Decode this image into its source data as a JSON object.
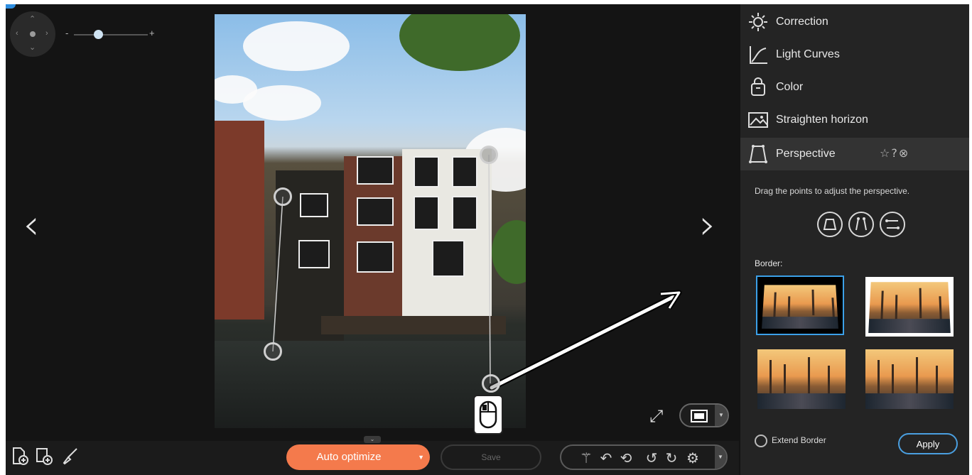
{
  "colors": {
    "accent_orange": "#f47a4c",
    "accent_blue": "#4a9fe0",
    "panel_bg": "#242424",
    "canvas_bg": "#141414"
  },
  "navigator": {
    "icon": "navigation-pad-icon",
    "zoom_minus": "-",
    "zoom_plus": "+",
    "zoom_level_fraction": 0.33
  },
  "nav_arrows": {
    "prev": "‹",
    "next": "›"
  },
  "sidebar": {
    "items": [
      {
        "label": "Correction",
        "icon": "sun-icon"
      },
      {
        "label": "Light Curves",
        "icon": "curve-icon"
      },
      {
        "label": "Color",
        "icon": "color-bag-icon"
      },
      {
        "label": "Straighten horizon",
        "icon": "landscape-icon"
      },
      {
        "label": "Perspective",
        "icon": "perspective-icon",
        "active": true,
        "actions": "☆⓪⊗"
      }
    ],
    "perspective": {
      "hint": "Drag the points to adjust the perspective.",
      "modes": [
        "trapezoid-mode-icon",
        "vertical-lines-mode-icon",
        "horizontal-lines-mode-icon"
      ],
      "border_label": "Border:",
      "extend_border_label": "Extend Border",
      "apply_label": "Apply"
    }
  },
  "bottombar": {
    "auto_optimize_label": "Auto optimize",
    "save_label": "Save",
    "tools": [
      "magic-wand-icon",
      "undo-icon",
      "undo-all-icon",
      "rotate-left-icon",
      "rotate-right-icon",
      "settings-icon"
    ]
  }
}
